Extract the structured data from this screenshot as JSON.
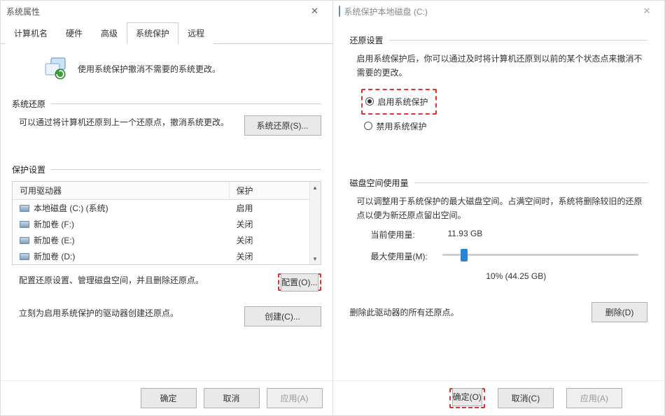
{
  "left": {
    "title": "系统属性",
    "tabs": [
      "计算机名",
      "硬件",
      "高级",
      "系统保护",
      "远程"
    ],
    "active_tab_index": 3,
    "intro": "使用系统保护撤消不需要的系统更改。",
    "section_restore": {
      "header": "系统还原",
      "text": "可以通过将计算机还原到上一个还原点，撤消系统更改。",
      "button": "系统还原(S)..."
    },
    "section_settings": {
      "header": "保护设置",
      "col1": "可用驱动器",
      "col2": "保护",
      "drives": [
        {
          "name": "本地磁盘 (C:) (系统)",
          "status": "启用"
        },
        {
          "name": "新加卷 (F:)",
          "status": "关闭"
        },
        {
          "name": "新加卷 (E:)",
          "status": "关闭"
        },
        {
          "name": "新加卷 (D:)",
          "status": "关闭"
        }
      ],
      "config_text": "配置还原设置、管理磁盘空间，并且删除还原点。",
      "config_button": "配置(O)...",
      "create_text": "立刻为启用系统保护的驱动器创建还原点。",
      "create_button": "创建(C)..."
    },
    "buttons": {
      "ok": "确定",
      "cancel": "取消",
      "apply": "应用(A)"
    }
  },
  "right": {
    "title": "系统保护本地磁盘 (C:)",
    "section_restore": {
      "header": "还原设置",
      "desc": "启用系统保护后，你可以通过及时将计算机还原到以前的某个状态点来撤消不需要的更改。",
      "opt_enable": "启用系统保护",
      "opt_disable": "禁用系统保护"
    },
    "section_usage": {
      "header": "磁盘空间使用量",
      "desc": "可以调整用于系统保护的最大磁盘空间。占满空间时，系统将删除较旧的还原点以便为新还原点留出空间。",
      "current_label": "当前使用量:",
      "current_value": "11.93 GB",
      "max_label": "最大使用量(M):",
      "slider_display": "10% (44.25 GB)",
      "delete_text": "删除此驱动器的所有还原点。",
      "delete_button": "删除(D)"
    },
    "buttons": {
      "ok": "确定(O)",
      "cancel": "取消(C)",
      "apply": "应用(A)"
    }
  }
}
